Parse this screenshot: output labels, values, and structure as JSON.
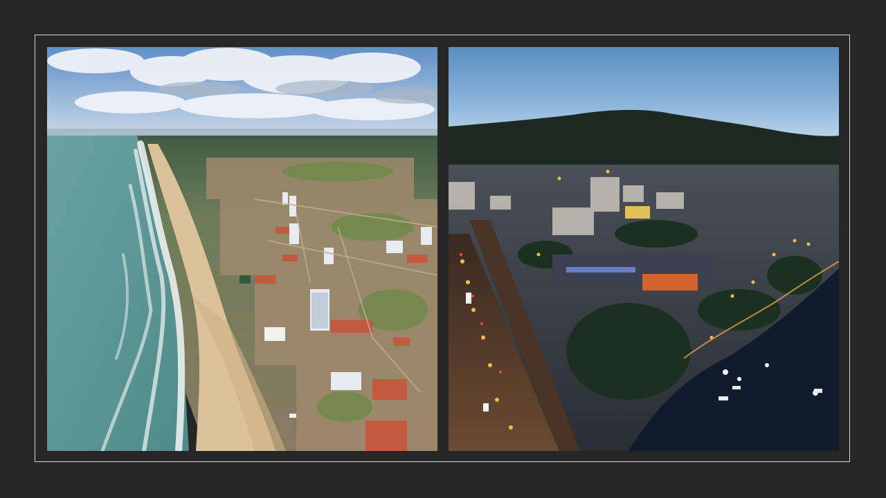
{
  "slide": {
    "background_color": "#262626",
    "frame_color": "#d8d8d8"
  },
  "photos": [
    {
      "id": "left",
      "subject": "daytime-aerial-beach-town",
      "palette": {
        "sky": "#7fa6d4",
        "cloud": "#e9eef4",
        "sea": "#5f9a98",
        "surf": "#eef3f2",
        "sand": "#d9bf96",
        "town": "#8f7f66",
        "roof": "#c0583f",
        "green": "#6e8a4a"
      }
    },
    {
      "id": "right",
      "subject": "dusk-aerial-lakeside-city",
      "palette": {
        "sky_top": "#5b8fc4",
        "sky_bottom": "#b9d3ea",
        "hill": "#1f2b22",
        "city": "#3a3f46",
        "road": "#2b2b30",
        "lights": "#ffb347",
        "water": "#0f1a2b",
        "trees": "#1e3322"
      }
    }
  ]
}
